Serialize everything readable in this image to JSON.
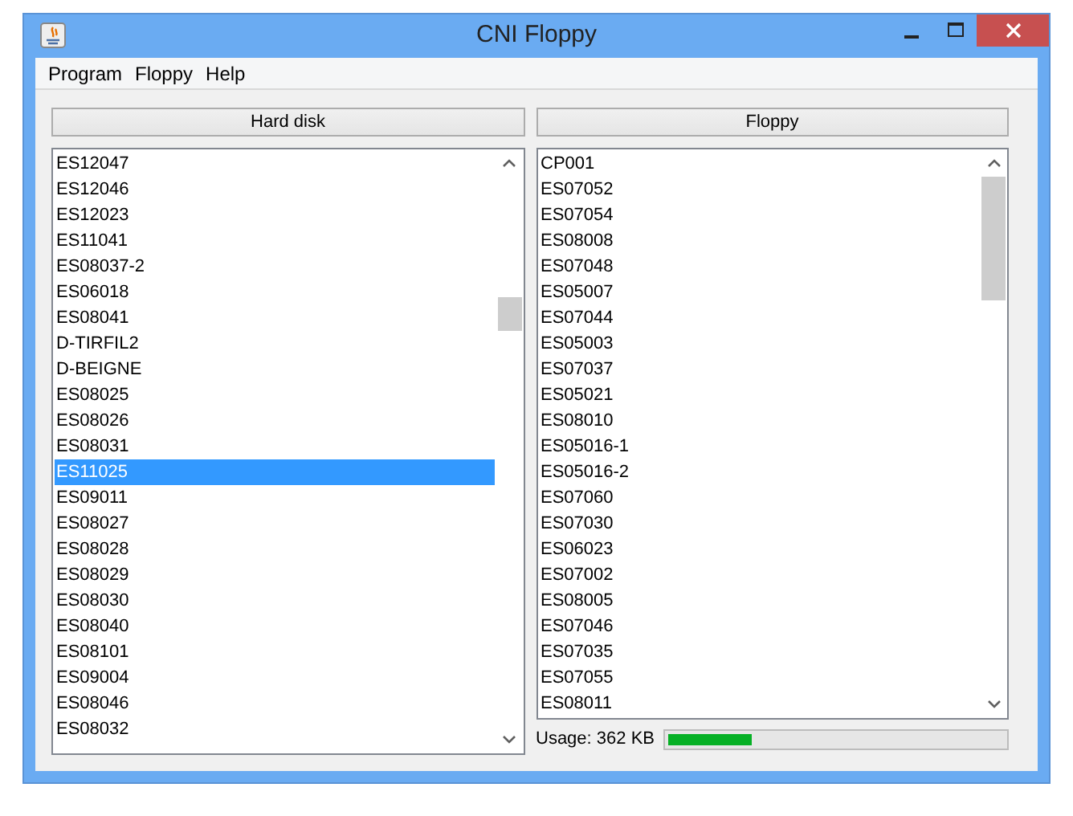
{
  "window": {
    "title": "CNI Floppy"
  },
  "menu": [
    "Program",
    "Floppy",
    "Help"
  ],
  "hard_disk": {
    "button": "Hard disk",
    "items": [
      {
        "label": "ES12047",
        "selected": false
      },
      {
        "label": "ES12046",
        "selected": false
      },
      {
        "label": "ES12023",
        "selected": false
      },
      {
        "label": "ES11041",
        "selected": false
      },
      {
        "label": "ES08037-2",
        "selected": false
      },
      {
        "label": "ES06018",
        "selected": false
      },
      {
        "label": "ES08041",
        "selected": false
      },
      {
        "label": "D-TIRFIL2",
        "selected": false
      },
      {
        "label": "D-BEIGNE",
        "selected": false
      },
      {
        "label": "ES08025",
        "selected": false
      },
      {
        "label": "ES08026",
        "selected": false
      },
      {
        "label": "ES08031",
        "selected": false
      },
      {
        "label": "ES11025",
        "selected": true
      },
      {
        "label": "ES09011",
        "selected": false
      },
      {
        "label": "ES08027",
        "selected": false
      },
      {
        "label": "ES08028",
        "selected": false
      },
      {
        "label": "ES08029",
        "selected": false
      },
      {
        "label": "ES08030",
        "selected": false
      },
      {
        "label": "ES08040",
        "selected": false
      },
      {
        "label": "ES08101",
        "selected": false
      },
      {
        "label": "ES09004",
        "selected": false
      },
      {
        "label": "ES08046",
        "selected": false
      },
      {
        "label": "ES08032",
        "selected": false
      }
    ]
  },
  "floppy": {
    "button": "Floppy",
    "items": [
      {
        "label": "CP001",
        "selected": false
      },
      {
        "label": "ES07052",
        "selected": false
      },
      {
        "label": "ES07054",
        "selected": false
      },
      {
        "label": "ES08008",
        "selected": false
      },
      {
        "label": "ES07048",
        "selected": false
      },
      {
        "label": "ES05007",
        "selected": false
      },
      {
        "label": "ES07044",
        "selected": false
      },
      {
        "label": "ES05003",
        "selected": false
      },
      {
        "label": "ES07037",
        "selected": false
      },
      {
        "label": "ES05021",
        "selected": false
      },
      {
        "label": "ES08010",
        "selected": false
      },
      {
        "label": "ES05016-1",
        "selected": false
      },
      {
        "label": "ES05016-2",
        "selected": false
      },
      {
        "label": "ES07060",
        "selected": false
      },
      {
        "label": "ES07030",
        "selected": false
      },
      {
        "label": "ES06023",
        "selected": false
      },
      {
        "label": "ES07002",
        "selected": false
      },
      {
        "label": "ES08005",
        "selected": false
      },
      {
        "label": "ES07046",
        "selected": false
      },
      {
        "label": "ES07035",
        "selected": false
      },
      {
        "label": "ES07055",
        "selected": false
      },
      {
        "label": "ES08011",
        "selected": false
      }
    ],
    "usage": {
      "label": "Usage: 362 KB",
      "level": 0.25
    }
  }
}
